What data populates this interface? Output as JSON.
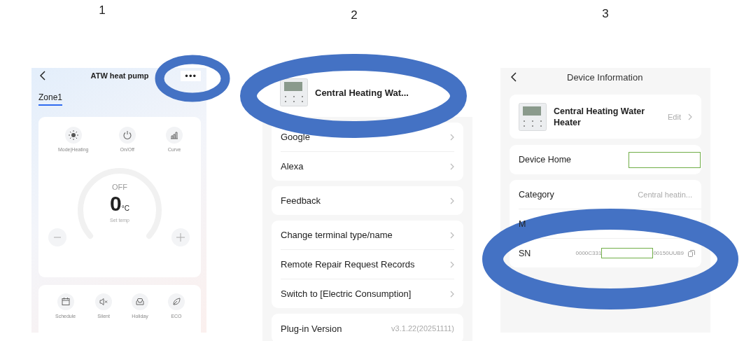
{
  "screens": [
    {
      "kind": "control",
      "number": "1",
      "title": "ATW heat pump",
      "more": "•••",
      "tabs": [
        {
          "label": "Zone1",
          "selected": true
        }
      ],
      "controls": [
        {
          "label": "Mode|Heating"
        },
        {
          "label": "On/Off"
        },
        {
          "label": "Curve"
        }
      ],
      "status": "OFF",
      "temperature": "0",
      "unit": "°C",
      "caption": "Set temp",
      "functions": [
        {
          "label": "Schedule"
        },
        {
          "label": "Silent"
        },
        {
          "label": "Holiday"
        },
        {
          "label": "ECO"
        }
      ]
    },
    {
      "kind": "settings",
      "number": "2",
      "device_name": "Central Heating Wat...",
      "groups": [
        {
          "items": [
            "Google",
            "Alexa"
          ]
        },
        {
          "items": [
            "Feedback"
          ]
        },
        {
          "items": [
            "Change terminal type/name",
            "Remote Repair Request Records",
            "Switch to [Electric Consumption]"
          ]
        }
      ],
      "version": {
        "label": "Plug-in Version",
        "value": "v3.1.22(20251111)"
      }
    },
    {
      "kind": "info",
      "number": "3",
      "title": "Device Information",
      "device_name": "Central Heating Water Heater",
      "edit": "Edit",
      "home_label": "Device Home",
      "rows": [
        {
          "kind": "text",
          "label": "Category",
          "value": "Central heatin..."
        },
        {
          "kind": "hidden",
          "label": "M"
        },
        {
          "kind": "serial",
          "label": "SN",
          "value_start": "0000C331",
          "value_end": "00150UUB9"
        }
      ]
    }
  ]
}
